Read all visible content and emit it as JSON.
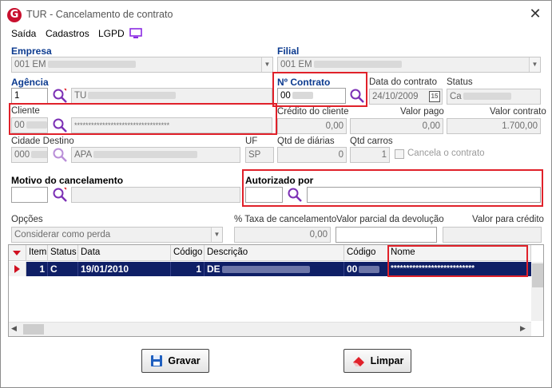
{
  "window": {
    "title": "TUR - Cancelamento de contrato",
    "logo": "G",
    "close": "✕"
  },
  "menu": {
    "saida": "Saída",
    "cadastros": "Cadastros",
    "lgpd": "LGPD"
  },
  "empresa": {
    "label": "Empresa",
    "value": "001 EM"
  },
  "filial": {
    "label": "Filial",
    "value": "001 EM"
  },
  "agencia": {
    "label": "Agência",
    "code": "1",
    "name": "TU"
  },
  "contrato": {
    "label": "Nº Contrato",
    "value": "00"
  },
  "data_contrato": {
    "label": "Data do contrato",
    "value": "24/10/2009",
    "cal": "15"
  },
  "status": {
    "label": "Status",
    "value": "Ca"
  },
  "cliente": {
    "label": "Cliente",
    "code": "00",
    "name": "**********************************"
  },
  "credito": {
    "label": "Crédito do cliente",
    "value": "0,00"
  },
  "valor_pago": {
    "label": "Valor pago",
    "value": "0,00"
  },
  "valor_contrato": {
    "label": "Valor contrato",
    "value": "1.700,00"
  },
  "cidade": {
    "label": "Cidade Destino",
    "code": "000",
    "name": "APA"
  },
  "uf": {
    "label": "UF",
    "value": "SP"
  },
  "diarias": {
    "label": "Qtd de diárias",
    "value": "0"
  },
  "carros": {
    "label": "Qtd carros",
    "value": "1"
  },
  "cancela": {
    "label": "Cancela o contrato"
  },
  "motivo": {
    "label": "Motivo do cancelamento",
    "code": "",
    "name": ""
  },
  "autorizado": {
    "label": "Autorizado por",
    "code": "",
    "name": ""
  },
  "opcoes": {
    "label": "Opções",
    "value": "Considerar como perda"
  },
  "taxa": {
    "label": "% Taxa de cancelamento",
    "value": "0,00"
  },
  "parcial": {
    "label": "Valor parcial da devolução",
    "value": ""
  },
  "credito_final": {
    "label": "Valor para crédito",
    "value": ""
  },
  "grid": {
    "headers": {
      "item": "Item",
      "status": "Status",
      "data": "Data",
      "codigo": "Código",
      "descricao": "Descrição",
      "codigo2": "Código",
      "nome": "Nome"
    },
    "row": {
      "item": "1",
      "status": "C",
      "data": "19/01/2010",
      "codigo": "1",
      "descricao": "DE",
      "codigo2": "00",
      "nome": "***************************"
    }
  },
  "buttons": {
    "gravar": "Gravar",
    "limpar": "Limpar"
  },
  "colors": {
    "accent_blue": "#0b3a8f",
    "highlight_red": "#e0212a",
    "selected_row": "#0f1f66",
    "lgpd_icon": "#8a2be2"
  }
}
